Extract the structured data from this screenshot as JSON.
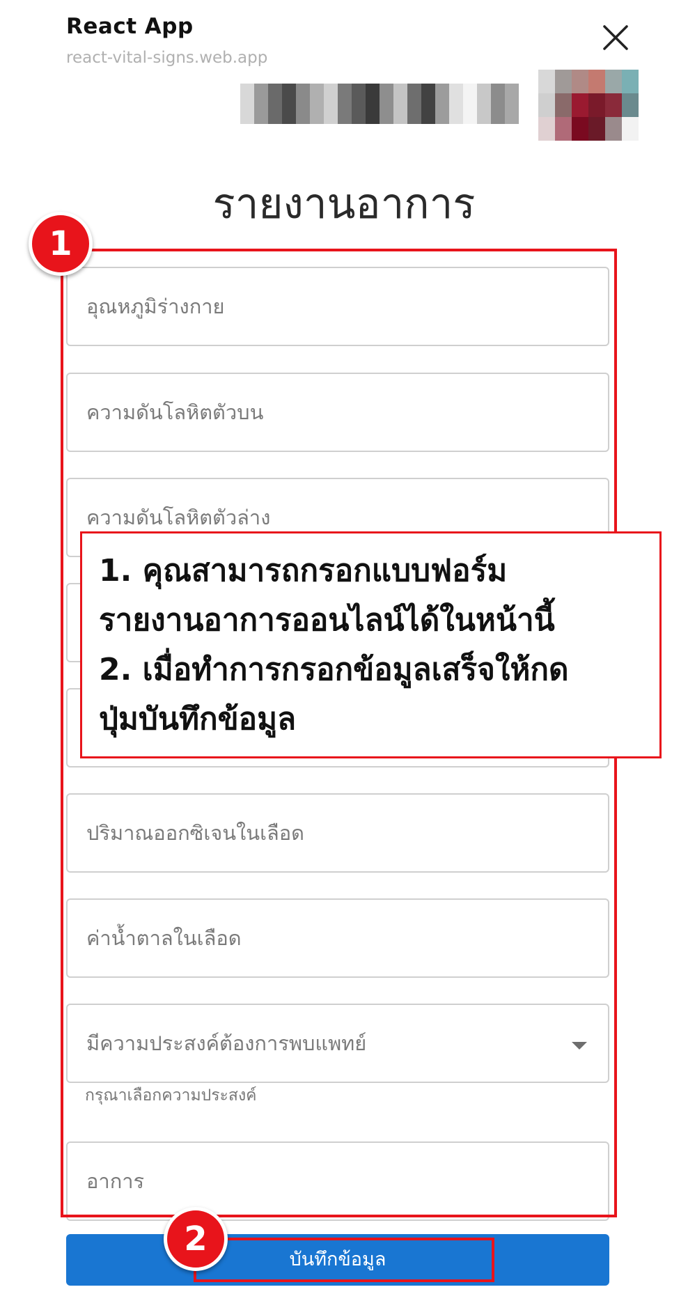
{
  "header": {
    "app_title": "React App",
    "app_url": "react-vital-signs.web.app",
    "close_icon": "close-icon"
  },
  "page": {
    "title": "รายงานอาการ"
  },
  "form": {
    "fields": [
      {
        "placeholder": "อุณหภูมิร่างกาย"
      },
      {
        "placeholder": "ความดันโลหิตตัวบน"
      },
      {
        "placeholder": "ความดันโลหิตตัวล่าง"
      },
      {
        "placeholder": ""
      },
      {
        "placeholder": ""
      },
      {
        "placeholder": "ปริมาณออกซิเจนในเลือด"
      },
      {
        "placeholder": "ค่าน้ำตาลในเลือด"
      }
    ],
    "select": {
      "placeholder": "มีความประสงค์ต้องการพบแพทย์",
      "helper": "กรุณาเลือกความประสงค์",
      "icon": "dropdown-arrow-icon"
    },
    "symptom": {
      "placeholder": "อาการ"
    },
    "save_label": "บันทึกข้อมูล"
  },
  "annotations": {
    "badge_1": "1",
    "badge_2": "2",
    "callout_lines": [
      "1. คุณสามารถกรอกแบบฟอร์ม",
      "รายงานอาการออนไลน์ได้ในหน้านี้",
      "2. เมื่อทำการกรอกข้อมูลเสร็จให้กด",
      "ปุ่มบันทึกข้อมูล"
    ],
    "color": "#e8141b"
  },
  "colors": {
    "primary_button": "#1976d2",
    "highlight": "#e8141b"
  }
}
